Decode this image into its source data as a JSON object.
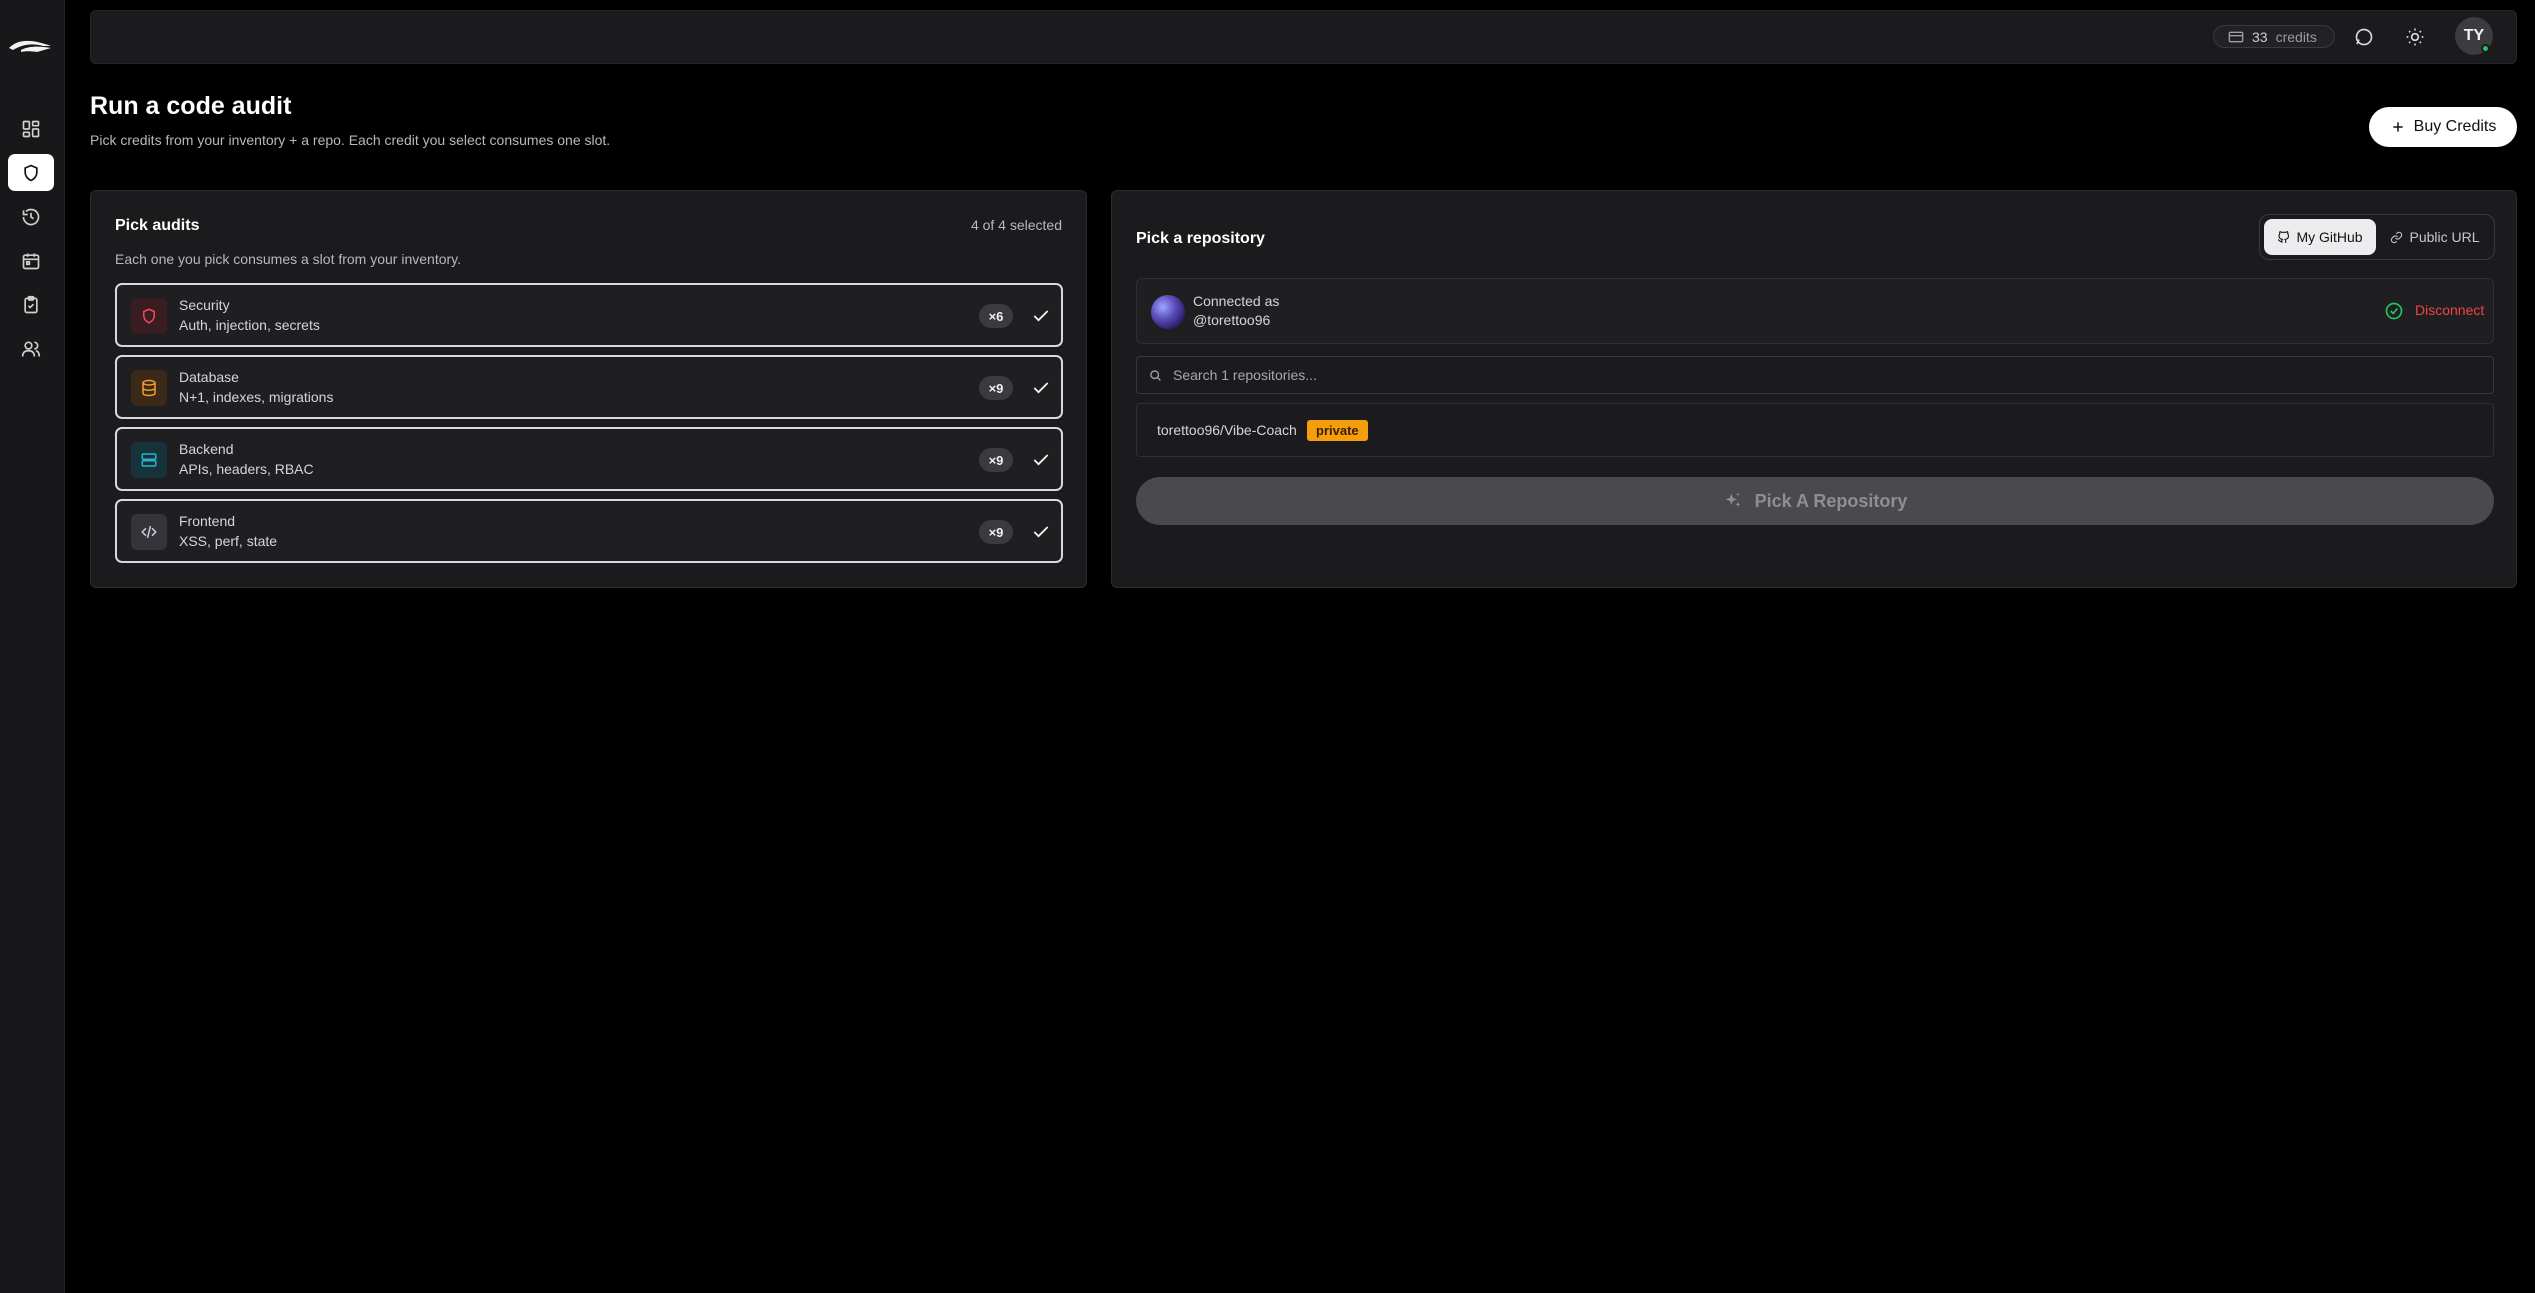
{
  "topbar": {
    "credits_count": "33",
    "credits_label": "credits",
    "user_initials": "TY"
  },
  "header": {
    "title": "Run a code audit",
    "subtitle": "Pick credits from your inventory + a repo. Each credit you select consumes one slot.",
    "buy_credits_label": "Buy Credits"
  },
  "audits": {
    "title": "Pick audits",
    "selected_text": "4 of 4 selected",
    "description": "Each one you pick consumes a slot from your inventory.",
    "items": [
      {
        "name": "Security",
        "subtitle": "Auth, injection, secrets",
        "qty": "×6",
        "icon": "shield-icon",
        "color": "#ef4b5a"
      },
      {
        "name": "Database",
        "subtitle": "N+1, indexes, migrations",
        "qty": "×9",
        "icon": "database-icon",
        "color": "#f59e2c"
      },
      {
        "name": "Backend",
        "subtitle": "APIs, headers, RBAC",
        "qty": "×9",
        "icon": "server-icon",
        "color": "#2bb3c9"
      },
      {
        "name": "Frontend",
        "subtitle": "XSS, perf, state",
        "qty": "×9",
        "icon": "code-icon",
        "color": "#cfcfd3"
      }
    ]
  },
  "repo": {
    "title": "Pick a repository",
    "tabs": {
      "github": "My GitHub",
      "url": "Public URL"
    },
    "connected_label": "Connected as",
    "username": "@torettoo96",
    "disconnect_label": "Disconnect",
    "search_placeholder": "Search 1 repositories...",
    "items": [
      {
        "name": "torettoo96/Vibe-Coach",
        "badge": "private"
      }
    ],
    "pick_button_label": "Pick A Repository"
  },
  "colors": {
    "accent_success": "#22c55e",
    "danger": "#ef4444",
    "private_badge": "#f59e0b"
  }
}
